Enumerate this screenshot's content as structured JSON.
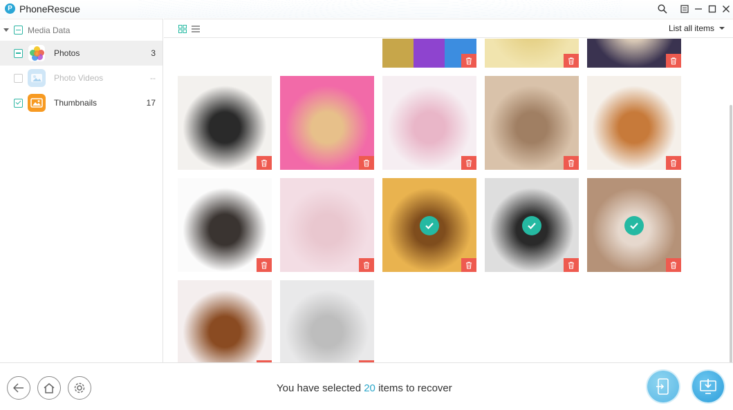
{
  "app": {
    "title": "PhoneRescue",
    "logo_letter": "P"
  },
  "window_controls": [
    "search-icon",
    "menu-icon",
    "minimize-icon",
    "maximize-icon",
    "close-icon"
  ],
  "sidebar": {
    "header": "Media Data",
    "items": [
      {
        "label": "Photos",
        "count": "3",
        "state": "partial",
        "active": true
      },
      {
        "label": "Photo Videos",
        "count": "--",
        "state": "disabled",
        "active": false
      },
      {
        "label": "Thumbnails",
        "count": "17",
        "state": "checked",
        "active": false
      }
    ]
  },
  "toolbar": {
    "filter_label": "List all items"
  },
  "grid": {
    "tiles": [
      {
        "name": "photo-partial-ios-icons",
        "colors": [
          "#c7a64a",
          "#8e44cf",
          "#3c8de0"
        ],
        "selected": false
      },
      {
        "name": "photo-partial-yellow",
        "colors": [
          "#f1e4ae",
          "#e6d289"
        ],
        "selected": false
      },
      {
        "name": "photo-partial-dark",
        "colors": [
          "#3a3350",
          "#d9c9b6"
        ],
        "selected": false
      },
      {
        "name": "photo-panda-puppy",
        "colors": [
          "#f3f1ee",
          "#2a2a2a"
        ],
        "selected": false
      },
      {
        "name": "photo-sleeping-puppy",
        "colors": [
          "#f26aa8",
          "#e7c08a"
        ],
        "selected": false
      },
      {
        "name": "photo-white-kitten",
        "colors": [
          "#f6eef2",
          "#e9b6c8"
        ],
        "selected": false
      },
      {
        "name": "photo-kitten-butterfly",
        "colors": [
          "#d9c2aa",
          "#a07f63"
        ],
        "selected": false
      },
      {
        "name": "photo-pomeranian",
        "colors": [
          "#f5f0ea",
          "#c77a3a"
        ],
        "selected": false
      },
      {
        "name": "photo-white-pomeranian",
        "colors": [
          "#fbfbfb",
          "#3a3431"
        ],
        "selected": false
      },
      {
        "name": "photo-pink-kitten",
        "colors": [
          "#f3dde4",
          "#e9c7cf"
        ],
        "selected": false
      },
      {
        "name": "photo-golden-puppy",
        "colors": [
          "#e9b34f",
          "#7f4d1d"
        ],
        "selected": true
      },
      {
        "name": "photo-two-cats",
        "colors": [
          "#dedede",
          "#2a2a2a"
        ],
        "selected": true
      },
      {
        "name": "photo-hamster",
        "colors": [
          "#b59278",
          "#e6d8cd"
        ],
        "selected": true
      },
      {
        "name": "photo-calico-kitten",
        "colors": [
          "#f4eeee",
          "#8a4b22"
        ],
        "selected": false
      },
      {
        "name": "photo-white-puppies",
        "colors": [
          "#e9e9ea",
          "#bdbdbd"
        ],
        "selected": false
      }
    ]
  },
  "bottom": {
    "status_prefix": "You have selected ",
    "selected_count": "20",
    "status_suffix": " items to recover",
    "buttons": [
      "back-icon",
      "home-icon",
      "settings-icon",
      "to-device-icon",
      "to-computer-icon"
    ]
  },
  "colors": {
    "accent": "#25b9a2",
    "delete": "#ee5a4f",
    "link": "#2aa6c9"
  }
}
